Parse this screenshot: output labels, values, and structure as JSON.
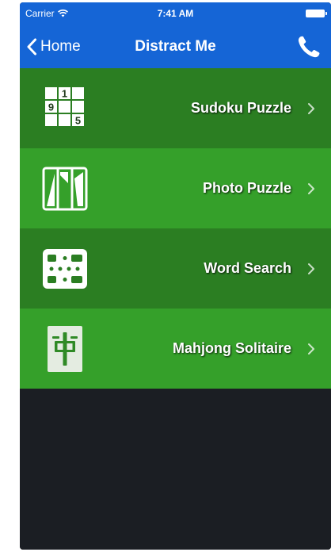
{
  "status_bar": {
    "carrier": "Carrier",
    "time": "7:41 AM",
    "wifi_icon": "wifi-icon",
    "battery_icon": "battery-icon"
  },
  "nav": {
    "back_label": "Home",
    "back_icon": "chevron-left-icon",
    "title": "Distract Me",
    "phone_icon": "phone-icon"
  },
  "menu": {
    "items": [
      {
        "label": "Sudoku Puzzle",
        "icon": "sudoku-icon",
        "sudoku_digits": [
          "1",
          "9",
          "5"
        ]
      },
      {
        "label": "Photo Puzzle",
        "icon": "photo-puzzle-icon"
      },
      {
        "label": "Word Search",
        "icon": "word-search-icon"
      },
      {
        "label": "Mahjong Solitaire",
        "icon": "mahjong-tile-icon"
      }
    ]
  },
  "colors": {
    "nav_blue": "#1565d6",
    "row_dark_green": "#2b7e22",
    "row_light_green": "#35a02a",
    "background_dark": "#1b1e23"
  }
}
